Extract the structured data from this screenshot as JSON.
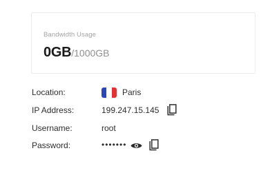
{
  "bandwidth": {
    "label": "Bandwidth Usage",
    "used": "0GB",
    "total": "/1000GB"
  },
  "server": {
    "location_label": "Location:",
    "location_value": "Paris",
    "location_flag": "france-flag-icon",
    "ip_label": "IP Address:",
    "ip_value": "199.247.15.145",
    "username_label": "Username:",
    "username_value": "root",
    "password_label": "Password:",
    "password_value": "•••••••"
  },
  "icons": {
    "copy": "copy-icon",
    "show_password": "eye-icon"
  },
  "colors": {
    "text_dark": "#2d2d2d",
    "text_muted": "#a3a3a3",
    "card_border": "#ececec",
    "flag_blue": "#2c48b8",
    "flag_red": "#e03232"
  }
}
